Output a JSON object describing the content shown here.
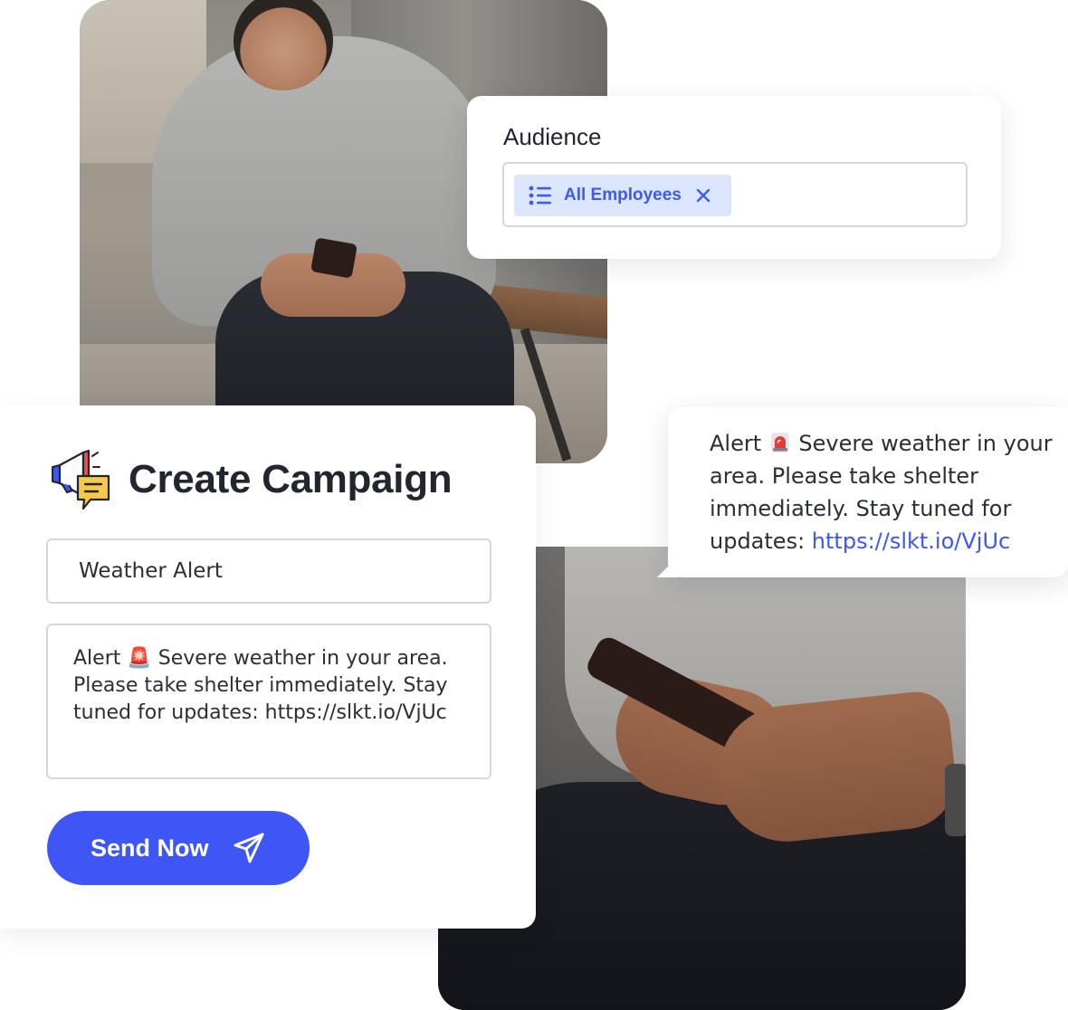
{
  "audience": {
    "title": "Audience",
    "chip_label": "All Employees"
  },
  "campaign": {
    "title": "Create Campaign",
    "name_value": "Weather Alert",
    "message_value": "Alert 🚨 Severe weather in your area. Please take shelter immediately. Stay tuned for updates: https://slkt.io/VjUc",
    "send_label": "Send Now"
  },
  "sms": {
    "prefix": "Alert",
    "body": "Severe weather in your area. Please take shelter immediately. Stay tuned for updates:",
    "link": "https://slkt.io/VjUc"
  },
  "colors": {
    "accent": "#3f56f6",
    "chip_bg": "#dbe5fb",
    "chip_text": "#3f5be8",
    "text": "#22262f",
    "border": "#d4d6dc"
  },
  "icons": {
    "list": "list-icon",
    "close": "close-icon",
    "campaign": "megaphone-chat-icon",
    "send": "paper-plane-icon",
    "siren": "siren-icon"
  }
}
